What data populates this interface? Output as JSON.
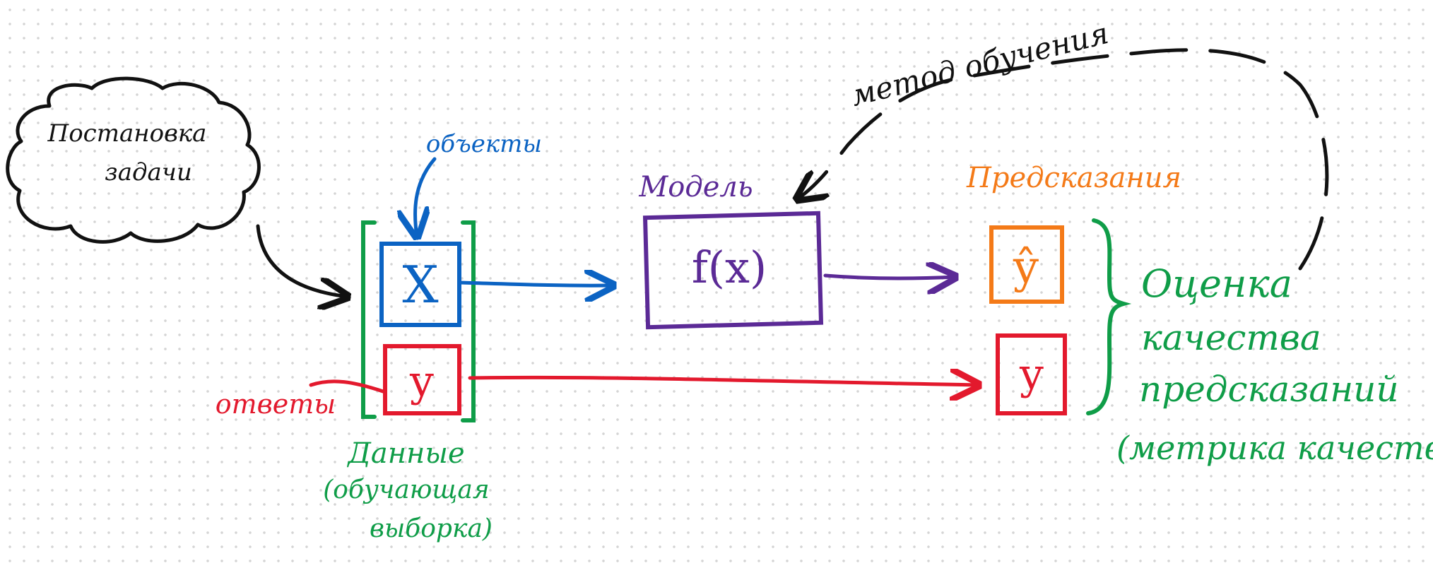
{
  "colors": {
    "ink": "#111111",
    "blue": "#0b63c3",
    "purple": "#5b2a96",
    "orange": "#f47a18",
    "red": "#e3192d",
    "green": "#0f9d48"
  },
  "nodes": {
    "task": "Постановка задачи",
    "objects_label": "объекты",
    "x_symbol": "X",
    "y_symbol": "y",
    "answers_label": "ответы",
    "data_line1": "Данные",
    "data_line2": "(обучающая",
    "data_line3": "выборка)",
    "model_label": "Модель",
    "model_function": "f(x)",
    "method_label": "метод обучения",
    "predictions_label": "Предсказания",
    "y_hat_symbol": "ŷ",
    "y_true_symbol": "y",
    "quality_line1": "Оценка",
    "quality_line2": "качества",
    "quality_line3": "предсказаний",
    "quality_line4": "(метрика качества)"
  }
}
